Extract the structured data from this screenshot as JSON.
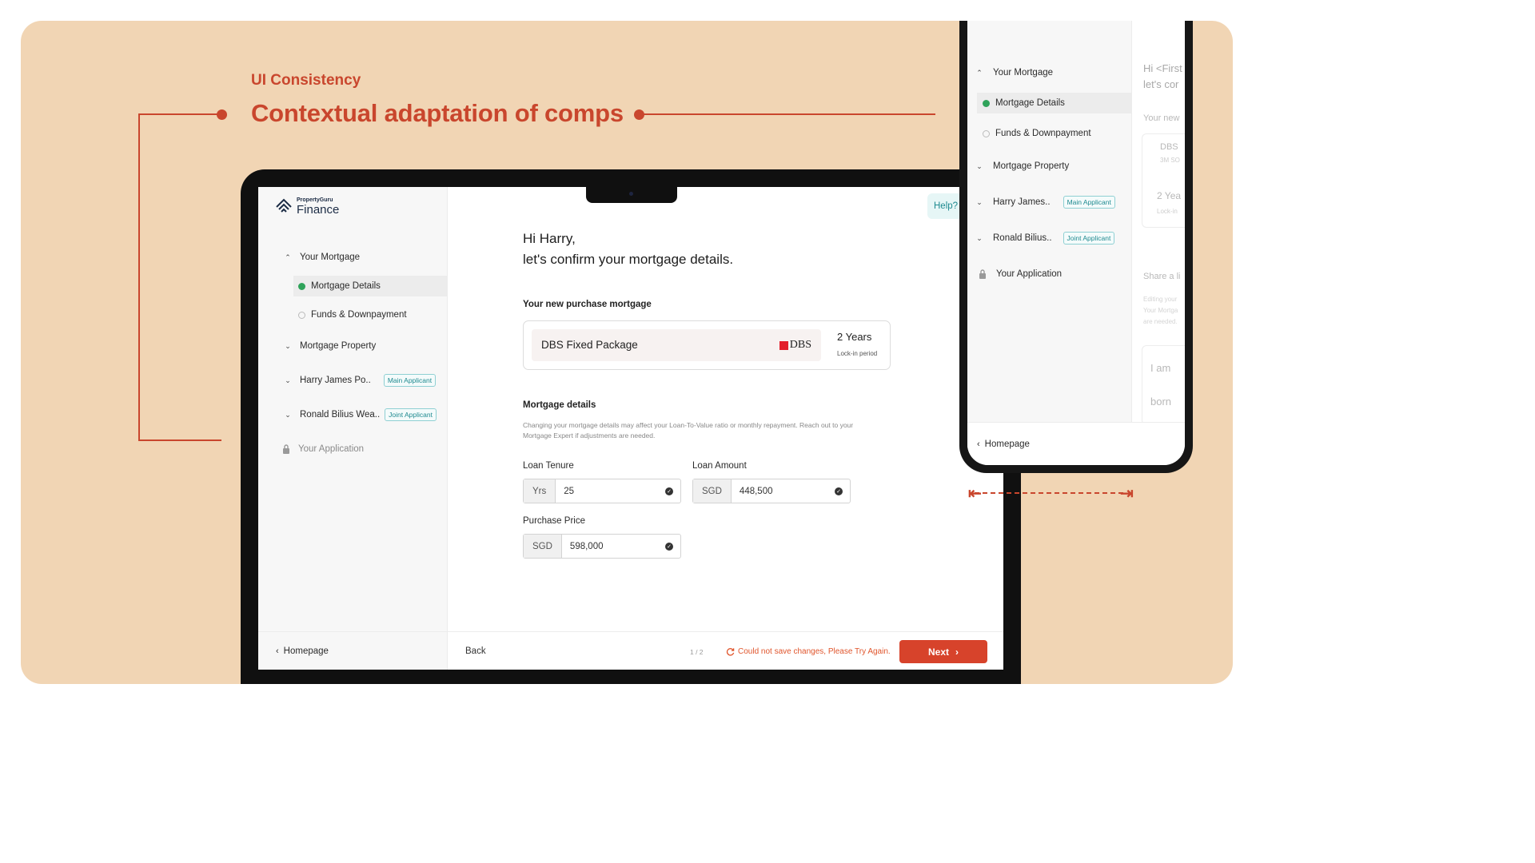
{
  "slide": {
    "eyebrow": "UI Consistency",
    "headline": "Contextual adaptation of comps"
  },
  "colors": {
    "accent": "#c9462d",
    "background": "#f1d5b4",
    "brand_teal": "#1f8a90",
    "success": "#2fa35a",
    "cta": "#d7432b"
  },
  "desktop": {
    "logo": {
      "small": "PropertyGuru",
      "big": "Finance"
    },
    "nav": {
      "your_mortgage": "Your Mortgage",
      "mortgage_details": "Mortgage Details",
      "funds": "Funds & Downpayment",
      "property": "Mortgage Property",
      "harry": "Harry James Po..",
      "main_badge": "Main Applicant",
      "ronald": "Ronald Bilius Wea..",
      "joint_badge": "Joint Applicant",
      "application": "Your Application"
    },
    "homepage": "Homepage",
    "help": "Help?",
    "greeting_line1": "Hi Harry,",
    "greeting_line2": "let's confirm your mortgage details.",
    "purchase_label": "Your new purchase mortgage",
    "package": {
      "name": "DBS Fixed Package",
      "bank": "DBS",
      "years": "2 Years",
      "lockin": "Lock-in period"
    },
    "details_label": "Mortgage details",
    "details_note": "Changing your mortgage details may affect your Loan-To-Value ratio or monthly repayment. Reach out to your Mortgage Expert if adjustments are needed.",
    "fields": {
      "tenure_label": "Loan Tenure",
      "tenure_prefix": "Yrs",
      "tenure_value": "25",
      "amount_label": "Loan Amount",
      "amount_prefix": "SGD",
      "amount_value": "448,500",
      "price_label": "Purchase Price",
      "price_prefix": "SGD",
      "price_value": "598,000"
    },
    "footer": {
      "back": "Back",
      "pager": "1 / 2",
      "error": "Could not save changes, Please Try Again.",
      "next": "Next"
    }
  },
  "mobile": {
    "nav": {
      "your_mortgage": "Your Mortgage",
      "mortgage_details": "Mortgage Details",
      "funds": "Funds & Downpayment",
      "property": "Mortgage Property",
      "harry": "Harry James..",
      "main_badge": "Main Applicant",
      "ronald": "Ronald Bilius..",
      "joint_badge": "Joint Applicant",
      "application": "Your Application"
    },
    "homepage": "Homepage",
    "peek": {
      "greet1": "Hi <First",
      "greet2": "let's cor",
      "your_new": "Your new",
      "dbs": "DBS",
      "sgd": "3M SO",
      "years": "2 Yea",
      "lockin": "Lock-in",
      "share": "Share a li",
      "edit1": "Editing your",
      "edit2": "Your Mortga",
      "edit3": "are needed.",
      "iam": "I am",
      "born": "born"
    }
  }
}
